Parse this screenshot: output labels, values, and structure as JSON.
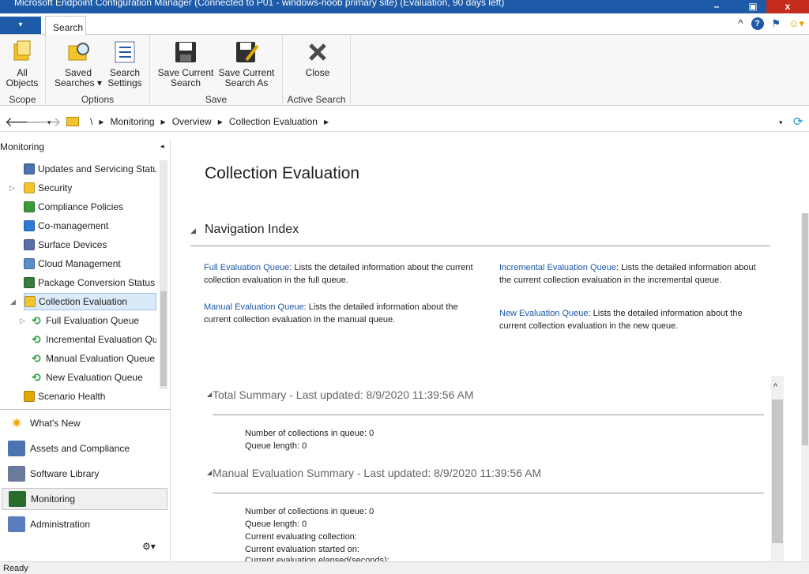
{
  "window": {
    "title": "Microsoft Endpoint Configuration Manager (Connected to P01 - windows-noob primary site) (Evaluation, 90 days left)",
    "minimize": "–",
    "maximize": "▣",
    "close": "x"
  },
  "ribbon_tabs": {
    "file": "▾",
    "search": "Search"
  },
  "ribbon": {
    "groups": [
      {
        "label": "Scope",
        "buttons": [
          {
            "label": "All Objects"
          }
        ]
      },
      {
        "label": "Options",
        "buttons": [
          {
            "label": "Saved Searches ▾"
          },
          {
            "label": "Search Settings"
          }
        ]
      },
      {
        "label": "Save",
        "buttons": [
          {
            "label": "Save Current Search"
          },
          {
            "label": "Save Current Search As"
          }
        ]
      },
      {
        "label": "Active Search",
        "buttons": [
          {
            "label": "Close"
          }
        ]
      }
    ]
  },
  "address": {
    "crumbs": [
      "\\",
      "Monitoring",
      "Overview",
      "Collection Evaluation"
    ]
  },
  "sidebar": {
    "title": "Monitoring",
    "tree": [
      {
        "label": "Updates and Servicing Status",
        "icon": "updates-icon"
      },
      {
        "label": "Security",
        "icon": "folder-icon"
      },
      {
        "label": "Compliance Policies",
        "icon": "compliance-icon"
      },
      {
        "label": "Co-management",
        "icon": "comanagement-icon"
      },
      {
        "label": "Surface Devices",
        "icon": "surface-icon"
      },
      {
        "label": "Cloud Management",
        "icon": "cloud-icon"
      },
      {
        "label": "Package Conversion Status",
        "icon": "chart-icon"
      },
      {
        "label": "Collection Evaluation",
        "icon": "folder-icon"
      },
      {
        "label": "Full Evaluation Queue",
        "icon": "refresh-icon"
      },
      {
        "label": "Incremental Evaluation Queue",
        "icon": "refresh-icon"
      },
      {
        "label": "Manual Evaluation Queue",
        "icon": "refresh-icon"
      },
      {
        "label": "New Evaluation Queue",
        "icon": "refresh-icon"
      },
      {
        "label": "Scenario Health",
        "icon": "health-icon"
      }
    ],
    "workspaces": [
      {
        "label": "What's New",
        "icon": "star-icon"
      },
      {
        "label": "Assets and Compliance",
        "icon": "assets-icon"
      },
      {
        "label": "Software Library",
        "icon": "library-icon"
      },
      {
        "label": "Monitoring",
        "icon": "monitor-icon"
      },
      {
        "label": "Administration",
        "icon": "admin-icon"
      }
    ]
  },
  "main": {
    "title": "Collection Evaluation",
    "nav_index": "Navigation Index",
    "links": [
      {
        "name": "Full Evaluation Queue",
        "desc": ": Lists the detailed information about the current collection evaluation in the full queue."
      },
      {
        "name": "Manual Evaluation Queue",
        "desc": ": Lists the detailed information about the current collection evaluation in the manual queue."
      },
      {
        "name": "Incremental Evaluation Queue",
        "desc": ": Lists the detailed information about the current collection evaluation in the incremental queue."
      },
      {
        "name": "New Evaluation Queue",
        "desc": ": Lists the detailed information about the current collection evaluation in the new queue."
      }
    ],
    "total_summary": {
      "title": "Total Summary - Last updated: 8/9/2020 11:39:56 AM",
      "rows": [
        "Number of collections in queue: 0",
        "Queue length: 0"
      ]
    },
    "manual_summary": {
      "title": "Manual Evaluation Summary - Last updated: 8/9/2020 11:39:56 AM",
      "rows": [
        "Number of collections in queue: 0",
        "Queue length: 0",
        "Current evaluating collection:",
        "Current evaluation started on:",
        "Current evaluation elapsed(seconds):"
      ]
    }
  },
  "status": "Ready"
}
